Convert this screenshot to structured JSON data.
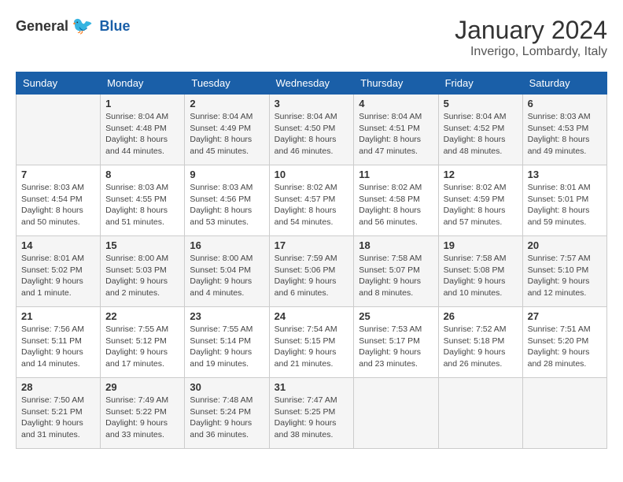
{
  "logo": {
    "general": "General",
    "blue": "Blue"
  },
  "header": {
    "month": "January 2024",
    "location": "Inverigo, Lombardy, Italy"
  },
  "weekdays": [
    "Sunday",
    "Monday",
    "Tuesday",
    "Wednesday",
    "Thursday",
    "Friday",
    "Saturday"
  ],
  "weeks": [
    [
      {
        "day": "",
        "sunrise": "",
        "sunset": "",
        "daylight": ""
      },
      {
        "day": "1",
        "sunrise": "Sunrise: 8:04 AM",
        "sunset": "Sunset: 4:48 PM",
        "daylight": "Daylight: 8 hours and 44 minutes."
      },
      {
        "day": "2",
        "sunrise": "Sunrise: 8:04 AM",
        "sunset": "Sunset: 4:49 PM",
        "daylight": "Daylight: 8 hours and 45 minutes."
      },
      {
        "day": "3",
        "sunrise": "Sunrise: 8:04 AM",
        "sunset": "Sunset: 4:50 PM",
        "daylight": "Daylight: 8 hours and 46 minutes."
      },
      {
        "day": "4",
        "sunrise": "Sunrise: 8:04 AM",
        "sunset": "Sunset: 4:51 PM",
        "daylight": "Daylight: 8 hours and 47 minutes."
      },
      {
        "day": "5",
        "sunrise": "Sunrise: 8:04 AM",
        "sunset": "Sunset: 4:52 PM",
        "daylight": "Daylight: 8 hours and 48 minutes."
      },
      {
        "day": "6",
        "sunrise": "Sunrise: 8:03 AM",
        "sunset": "Sunset: 4:53 PM",
        "daylight": "Daylight: 8 hours and 49 minutes."
      }
    ],
    [
      {
        "day": "7",
        "sunrise": "Sunrise: 8:03 AM",
        "sunset": "Sunset: 4:54 PM",
        "daylight": "Daylight: 8 hours and 50 minutes."
      },
      {
        "day": "8",
        "sunrise": "Sunrise: 8:03 AM",
        "sunset": "Sunset: 4:55 PM",
        "daylight": "Daylight: 8 hours and 51 minutes."
      },
      {
        "day": "9",
        "sunrise": "Sunrise: 8:03 AM",
        "sunset": "Sunset: 4:56 PM",
        "daylight": "Daylight: 8 hours and 53 minutes."
      },
      {
        "day": "10",
        "sunrise": "Sunrise: 8:02 AM",
        "sunset": "Sunset: 4:57 PM",
        "daylight": "Daylight: 8 hours and 54 minutes."
      },
      {
        "day": "11",
        "sunrise": "Sunrise: 8:02 AM",
        "sunset": "Sunset: 4:58 PM",
        "daylight": "Daylight: 8 hours and 56 minutes."
      },
      {
        "day": "12",
        "sunrise": "Sunrise: 8:02 AM",
        "sunset": "Sunset: 4:59 PM",
        "daylight": "Daylight: 8 hours and 57 minutes."
      },
      {
        "day": "13",
        "sunrise": "Sunrise: 8:01 AM",
        "sunset": "Sunset: 5:01 PM",
        "daylight": "Daylight: 8 hours and 59 minutes."
      }
    ],
    [
      {
        "day": "14",
        "sunrise": "Sunrise: 8:01 AM",
        "sunset": "Sunset: 5:02 PM",
        "daylight": "Daylight: 9 hours and 1 minute."
      },
      {
        "day": "15",
        "sunrise": "Sunrise: 8:00 AM",
        "sunset": "Sunset: 5:03 PM",
        "daylight": "Daylight: 9 hours and 2 minutes."
      },
      {
        "day": "16",
        "sunrise": "Sunrise: 8:00 AM",
        "sunset": "Sunset: 5:04 PM",
        "daylight": "Daylight: 9 hours and 4 minutes."
      },
      {
        "day": "17",
        "sunrise": "Sunrise: 7:59 AM",
        "sunset": "Sunset: 5:06 PM",
        "daylight": "Daylight: 9 hours and 6 minutes."
      },
      {
        "day": "18",
        "sunrise": "Sunrise: 7:58 AM",
        "sunset": "Sunset: 5:07 PM",
        "daylight": "Daylight: 9 hours and 8 minutes."
      },
      {
        "day": "19",
        "sunrise": "Sunrise: 7:58 AM",
        "sunset": "Sunset: 5:08 PM",
        "daylight": "Daylight: 9 hours and 10 minutes."
      },
      {
        "day": "20",
        "sunrise": "Sunrise: 7:57 AM",
        "sunset": "Sunset: 5:10 PM",
        "daylight": "Daylight: 9 hours and 12 minutes."
      }
    ],
    [
      {
        "day": "21",
        "sunrise": "Sunrise: 7:56 AM",
        "sunset": "Sunset: 5:11 PM",
        "daylight": "Daylight: 9 hours and 14 minutes."
      },
      {
        "day": "22",
        "sunrise": "Sunrise: 7:55 AM",
        "sunset": "Sunset: 5:12 PM",
        "daylight": "Daylight: 9 hours and 17 minutes."
      },
      {
        "day": "23",
        "sunrise": "Sunrise: 7:55 AM",
        "sunset": "Sunset: 5:14 PM",
        "daylight": "Daylight: 9 hours and 19 minutes."
      },
      {
        "day": "24",
        "sunrise": "Sunrise: 7:54 AM",
        "sunset": "Sunset: 5:15 PM",
        "daylight": "Daylight: 9 hours and 21 minutes."
      },
      {
        "day": "25",
        "sunrise": "Sunrise: 7:53 AM",
        "sunset": "Sunset: 5:17 PM",
        "daylight": "Daylight: 9 hours and 23 minutes."
      },
      {
        "day": "26",
        "sunrise": "Sunrise: 7:52 AM",
        "sunset": "Sunset: 5:18 PM",
        "daylight": "Daylight: 9 hours and 26 minutes."
      },
      {
        "day": "27",
        "sunrise": "Sunrise: 7:51 AM",
        "sunset": "Sunset: 5:20 PM",
        "daylight": "Daylight: 9 hours and 28 minutes."
      }
    ],
    [
      {
        "day": "28",
        "sunrise": "Sunrise: 7:50 AM",
        "sunset": "Sunset: 5:21 PM",
        "daylight": "Daylight: 9 hours and 31 minutes."
      },
      {
        "day": "29",
        "sunrise": "Sunrise: 7:49 AM",
        "sunset": "Sunset: 5:22 PM",
        "daylight": "Daylight: 9 hours and 33 minutes."
      },
      {
        "day": "30",
        "sunrise": "Sunrise: 7:48 AM",
        "sunset": "Sunset: 5:24 PM",
        "daylight": "Daylight: 9 hours and 36 minutes."
      },
      {
        "day": "31",
        "sunrise": "Sunrise: 7:47 AM",
        "sunset": "Sunset: 5:25 PM",
        "daylight": "Daylight: 9 hours and 38 minutes."
      },
      {
        "day": "",
        "sunrise": "",
        "sunset": "",
        "daylight": ""
      },
      {
        "day": "",
        "sunrise": "",
        "sunset": "",
        "daylight": ""
      },
      {
        "day": "",
        "sunrise": "",
        "sunset": "",
        "daylight": ""
      }
    ]
  ]
}
